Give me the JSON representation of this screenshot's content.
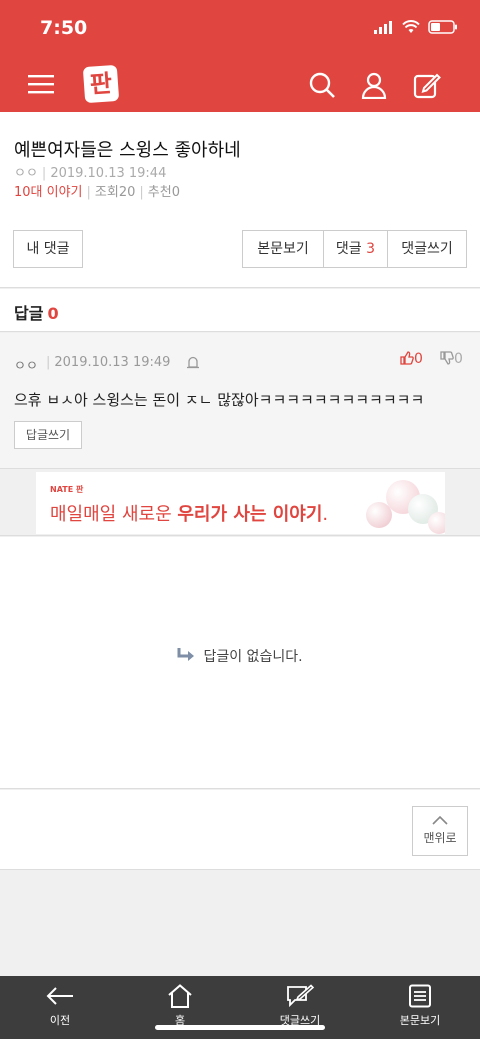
{
  "status_bar": {
    "time": "7:50"
  },
  "header": {
    "logo_text": "판"
  },
  "article": {
    "title": "예쁜여자들은 스윙스 좋아하네",
    "author": "ㅇㅇ",
    "datetime": "2019.10.13 19:44",
    "category": "10대 이야기",
    "views_label": "조회",
    "views": "20",
    "recommend_label": "추천",
    "recommend": "0"
  },
  "buttons": {
    "my_comments": "내 댓글",
    "view_body": "본문보기",
    "comments_label": "댓글",
    "comments_count": "3",
    "write_comment": "댓글쓰기"
  },
  "replies": {
    "label": "답글",
    "count": "0"
  },
  "comment": {
    "author": "ㅇㅇ",
    "datetime": "2019.10.13 19:49",
    "likes": "0",
    "dislikes": "0",
    "text": "으휴 ㅂㅅ아 스윙스는 돈이 ㅈㄴ 많잖아ㅋㅋㅋㅋㅋㅋㅋㅋㅋㅋㅋㅋ",
    "reply_button": "답글쓰기"
  },
  "ad": {
    "brand": "NATE 판",
    "copy_prefix": "매일매일 새로운 ",
    "copy_bold": "우리가 사는 이야기",
    "copy_suffix": "."
  },
  "empty_state": {
    "message": "답글이 없습니다."
  },
  "to_top": {
    "label": "맨위로"
  },
  "bottom_nav": [
    {
      "label": "이전",
      "icon": "back-arrow-icon"
    },
    {
      "label": "홈",
      "icon": "home-icon"
    },
    {
      "label": "댓글쓰기",
      "icon": "write-comment-icon"
    },
    {
      "label": "본문보기",
      "icon": "document-icon"
    }
  ],
  "colors": {
    "brand_red": "#e0453f",
    "bottom_bar": "#3d3d3d"
  }
}
